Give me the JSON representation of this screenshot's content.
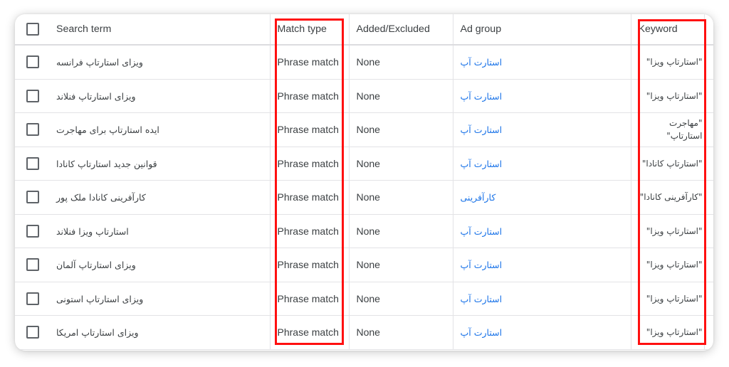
{
  "table": {
    "headers": {
      "select_all": "",
      "search_term": "Search term",
      "match_type": "Match type",
      "added_excluded": "Added/Excluded",
      "ad_group": "Ad group",
      "keyword": "Keyword"
    },
    "rows": [
      {
        "search_term": "ویزای استارتاپ فرانسه",
        "match_type": "Phrase match",
        "added_excluded": "None",
        "ad_group": "استارت آپ",
        "keyword": "\"استارتاپ ویزا\""
      },
      {
        "search_term": "ویزای استارتاپ فنلاند",
        "match_type": "Phrase match",
        "added_excluded": "None",
        "ad_group": "استارت آپ",
        "keyword": "\"استارتاپ ویزا\""
      },
      {
        "search_term": "ایده استارتاپ برای مهاجرت",
        "match_type": "Phrase match",
        "added_excluded": "None",
        "ad_group": "استارت آپ",
        "keyword": "\"مهاجرت استارتاپ\""
      },
      {
        "search_term": "قوانین جدید استارتاپ کانادا",
        "match_type": "Phrase match",
        "added_excluded": "None",
        "ad_group": "استارت آپ",
        "keyword": "\"استارتاپ کانادا\""
      },
      {
        "search_term": "کارآفرینی کانادا ملک پور",
        "match_type": "Phrase match",
        "added_excluded": "None",
        "ad_group": "کارآفرینی",
        "keyword": "\"کارآفرینی کانادا\""
      },
      {
        "search_term": "استارتاپ ویزا فنلاند",
        "match_type": "Phrase match",
        "added_excluded": "None",
        "ad_group": "استارت آپ",
        "keyword": "\"استارتاپ ویزا\""
      },
      {
        "search_term": "ویزای استارتاپ آلمان",
        "match_type": "Phrase match",
        "added_excluded": "None",
        "ad_group": "استارت آپ",
        "keyword": "\"استارتاپ ویزا\""
      },
      {
        "search_term": "ویزای استارتاپ استونی",
        "match_type": "Phrase match",
        "added_excluded": "None",
        "ad_group": "استارت آپ",
        "keyword": "\"استارتاپ ویزا\""
      },
      {
        "search_term": "ویزای استارتاپ امریکا",
        "match_type": "Phrase match",
        "added_excluded": "None",
        "ad_group": "استارت آپ",
        "keyword": "\"استارتاپ ویزا\""
      }
    ]
  },
  "annotations": {
    "highlight_color": "#ff1010",
    "highlighted_columns": [
      "Match type",
      "Keyword"
    ]
  },
  "colors": {
    "link": "#1a73e8",
    "text": "#3c4043",
    "border": "#e3e3e6"
  }
}
